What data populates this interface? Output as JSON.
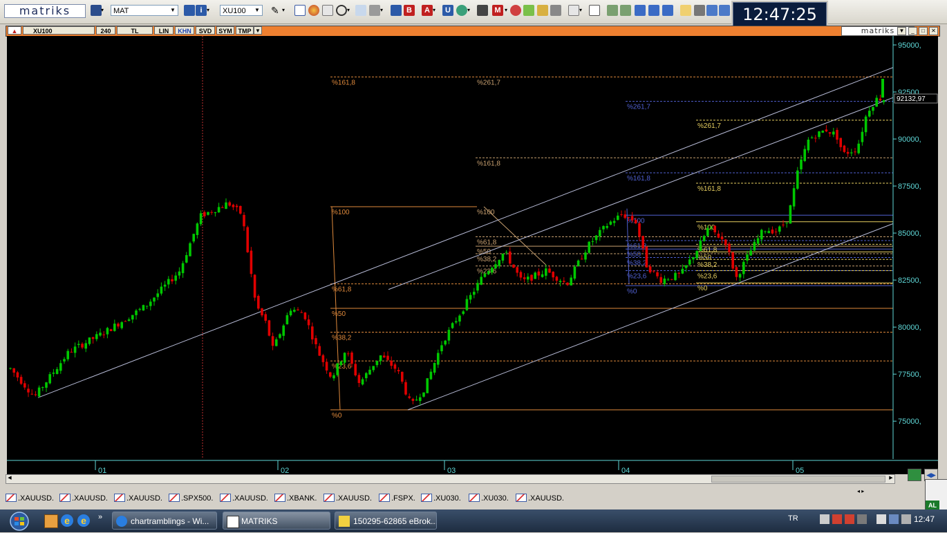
{
  "app": {
    "logo": "matriks",
    "clock": "12:47:25",
    "brand": "matriks"
  },
  "toolbar": {
    "template_value": "MAT",
    "symbol_value": "XU100"
  },
  "chart_window": {
    "symbol": "XU100",
    "period": "240",
    "buttons": [
      "TL",
      "LIN",
      "KHN",
      "SVD",
      "SYM",
      "TMP"
    ],
    "active_button": "KHN"
  },
  "chart": {
    "price_axis": [
      "95000,",
      "92500,",
      "90000,",
      "87500,",
      "85000,",
      "82500,",
      "80000,",
      "77500,",
      "75000,"
    ],
    "last_price": "92132,97",
    "time_axis": [
      "01",
      "02",
      "03",
      "04",
      "05"
    ],
    "fib_labels": {
      "first": [
        "%161,8",
        "%100",
        "%61,8",
        "%50",
        "%38,2",
        "%23,6",
        "%0"
      ],
      "second": [
        "%261,7",
        "%161,8",
        "%100",
        "%61,8",
        "%50",
        "%38,2",
        "%23,6"
      ],
      "third": [
        "%261,7",
        "%161,8",
        "%100",
        "%61,8",
        "%50",
        "%38,2",
        "%23,6",
        "%0"
      ],
      "fourth": [
        "%261,7",
        "%161,8",
        "%100",
        "%61,8",
        "%50",
        "%38,2",
        "%23,6",
        "%0"
      ]
    },
    "colors": {
      "background": "#000000",
      "up": "#00c800",
      "down": "#e00000",
      "fib_orange": "#e08a3c",
      "fib_blue": "#5060d0",
      "fib_yellow": "#e8d060",
      "channel": "#b8bcd8",
      "axis": "#5fd8d8"
    }
  },
  "symbol_tabs": [
    ".XAUUSD.",
    ".XAUUSD.",
    ".XAUUSD.",
    ".SPX500.",
    ".XAUUSD.",
    ".XBANK.",
    ".XAUUSD.",
    ".FSPX.",
    ".XU030.",
    ".XU030.",
    ".XAUUSD."
  ],
  "taskbar": {
    "tasks": [
      "chartramblings - Wi...",
      "MATRIKS",
      "150295-62865 eBrok..."
    ],
    "language": "TR",
    "time": "12:47"
  }
}
